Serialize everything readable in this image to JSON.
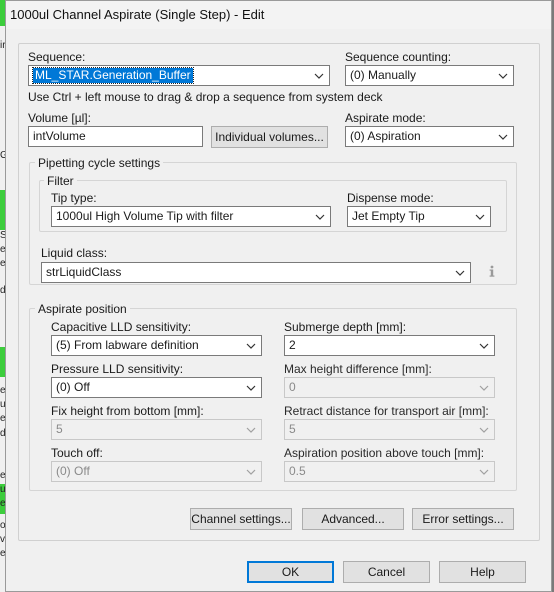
{
  "window": {
    "title": "1000ul Channel Aspirate (Single Step) - Edit"
  },
  "background_chars": [
    "ir",
    "G",
    "S",
    "e",
    "e",
    "d",
    "e",
    "u",
    "e",
    "d",
    "e",
    "u",
    "e",
    "or",
    "ve",
    "e"
  ],
  "sequence": {
    "label": "Sequence:",
    "value": "ML_STAR.Generation_Buffer",
    "hint": "Use Ctrl + left mouse to drag & drop a sequence from system deck"
  },
  "sequence_counting": {
    "label": "Sequence counting:",
    "value": "(0) Manually"
  },
  "volume": {
    "label": "Volume [µl]:",
    "value": "intVolume",
    "button": "Individual volumes..."
  },
  "aspirate_mode": {
    "label": "Aspirate mode:",
    "value": "(0) Aspiration"
  },
  "pipetting": {
    "title": "Pipetting cycle settings",
    "filter_title": "Filter",
    "tip_type": {
      "label": "Tip type:",
      "value": "1000ul High Volume Tip with filter"
    },
    "dispense_mode": {
      "label": "Dispense mode:",
      "value": "Jet Empty Tip"
    },
    "liquid_class": {
      "label": "Liquid class:",
      "value": "strLiquidClass"
    }
  },
  "aspirate_position": {
    "title": "Aspirate position",
    "capacitive_lld": {
      "label": "Capacitive LLD sensitivity:",
      "value": "(5) From labware definition"
    },
    "submerge_depth": {
      "label": "Submerge depth [mm]:",
      "value": "2"
    },
    "pressure_lld": {
      "label": "Pressure LLD sensitivity:",
      "value": "(0) Off"
    },
    "max_height_diff": {
      "label": "Max height difference [mm]:",
      "value": "0"
    },
    "fix_height": {
      "label": "Fix height from bottom [mm]:",
      "value": "5"
    },
    "retract_distance": {
      "label": "Retract distance for transport air [mm]:",
      "value": "5"
    },
    "touch_off": {
      "label": "Touch off:",
      "value": "(0) Off"
    },
    "aspiration_above_touch": {
      "label": "Aspiration position above touch [mm]:",
      "value": "0.5"
    }
  },
  "buttons": {
    "channel_settings": "Channel settings...",
    "advanced": "Advanced...",
    "error_settings": "Error settings...",
    "ok": "OK",
    "cancel": "Cancel",
    "help": "Help"
  },
  "colors": {
    "accent": "#0078d7",
    "background_mark": "#3ccd3c"
  }
}
